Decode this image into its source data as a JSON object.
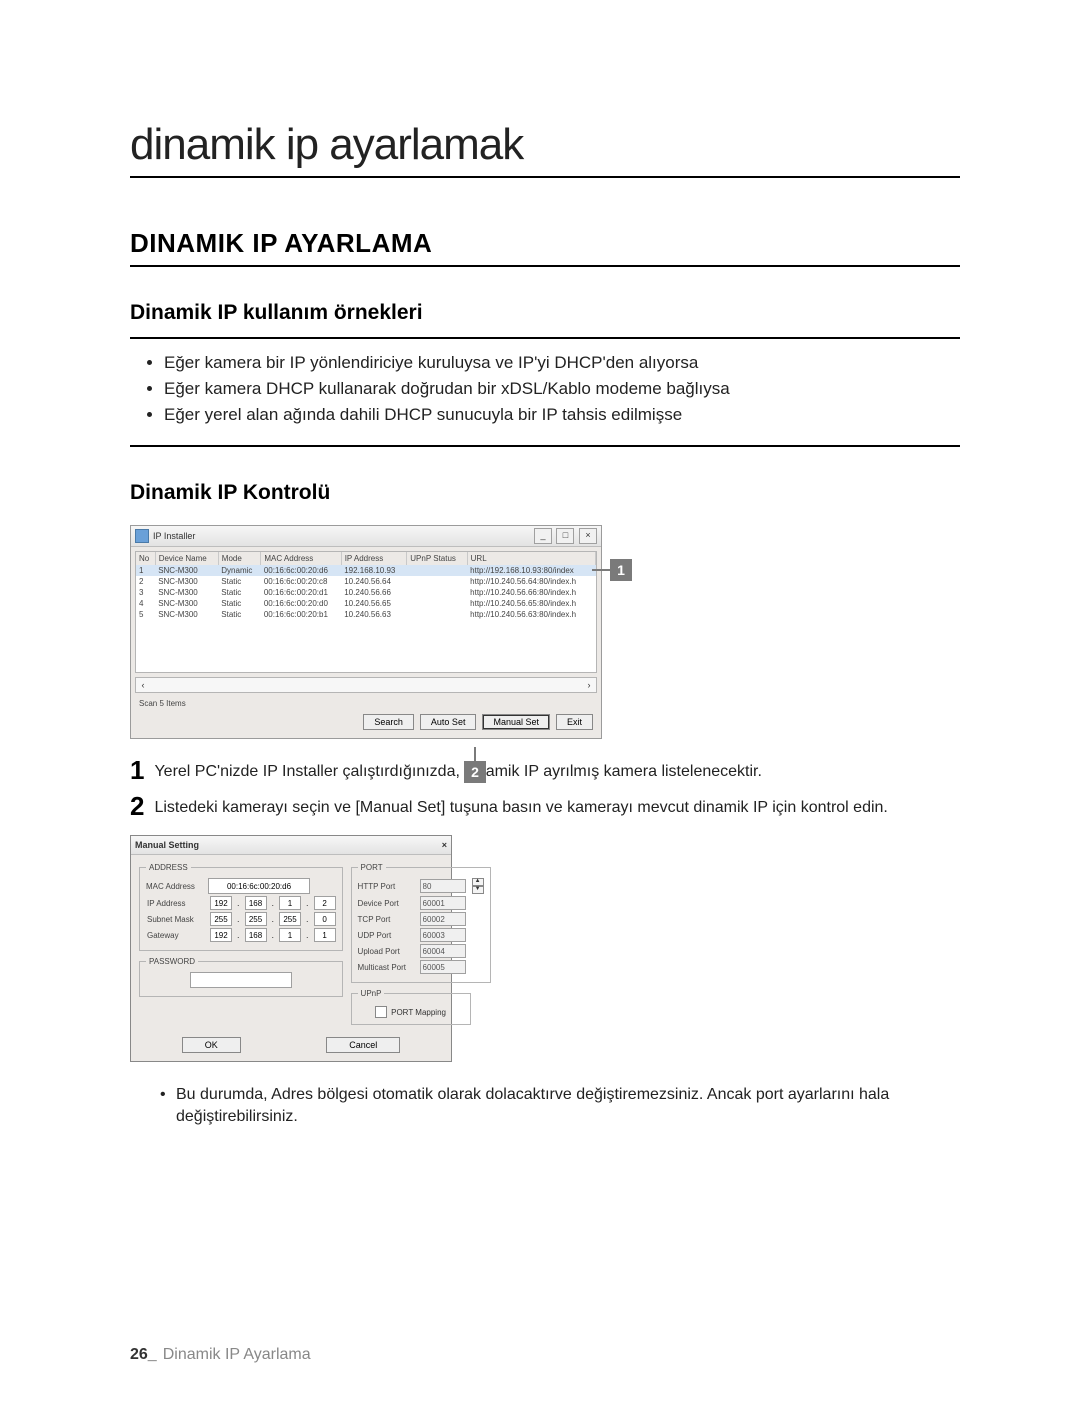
{
  "title": "dinamik ip ayarlamak",
  "h2": "DINAMIK IP AYARLAMA",
  "h3a": "Dinamik IP kullanım örnekleri",
  "bullets": [
    "Eğer kamera bir IP yönlendiriciye kuruluysa ve IP'yi DHCP'den alıyorsa",
    "Eğer kamera DHCP kullanarak doğrudan bir xDSL/Kablo modeme bağlıysa",
    "Eğer yerel alan ağında dahili DHCP sunucuyla bir IP tahsis edilmişse"
  ],
  "h3b": "Dinamik IP Kontrolü",
  "installer": {
    "title": "IP Installer",
    "cols": [
      "No",
      "Device Name",
      "Mode",
      "MAC Address",
      "IP Address",
      "UPnP Status",
      "URL"
    ],
    "rows": [
      {
        "no": "1",
        "name": "SNC-M300",
        "mode": "Dynamic",
        "mac": "00:16:6c:00:20:d6",
        "ip": "192.168.10.93",
        "url": "http://192.168.10.93:80/index"
      },
      {
        "no": "2",
        "name": "SNC-M300",
        "mode": "Static",
        "mac": "00:16:6c:00:20:c8",
        "ip": "10.240.56.64",
        "url": "http://10.240.56.64:80/index.h"
      },
      {
        "no": "3",
        "name": "SNC-M300",
        "mode": "Static",
        "mac": "00:16:6c:00:20:d1",
        "ip": "10.240.56.66",
        "url": "http://10.240.56.66:80/index.h"
      },
      {
        "no": "4",
        "name": "SNC-M300",
        "mode": "Static",
        "mac": "00:16:6c:00:20:d0",
        "ip": "10.240.56.65",
        "url": "http://10.240.56.65:80/index.h"
      },
      {
        "no": "5",
        "name": "SNC-M300",
        "mode": "Static",
        "mac": "00:16:6c:00:20:b1",
        "ip": "10.240.56.63",
        "url": "http://10.240.56.63:80/index.h"
      }
    ],
    "status": "Scan 5 Items",
    "btn_search": "Search",
    "btn_auto": "Auto Set",
    "btn_manual": "Manual Set",
    "btn_exit": "Exit"
  },
  "callout1": "1",
  "callout2": "2",
  "step1": "Yerel PC'nizde IP Installer çalıştırdığınızda, dinamik IP ayrılmış kamera listelenecektir.",
  "step2": "Listedeki kamerayı seçin ve [Manual Set] tuşuna basın ve kamerayı mevcut dinamik IP için kontrol edin.",
  "dlg": {
    "title": "Manual Setting",
    "grp_addr": "ADDRESS",
    "mac_lbl": "MAC Address",
    "mac_val": "00:16:6c:00:20:d6",
    "ip_lbl": "IP Address",
    "ip": [
      "192",
      "168",
      "1",
      "2"
    ],
    "sm_lbl": "Subnet Mask",
    "sm": [
      "255",
      "255",
      "255",
      "0"
    ],
    "gw_lbl": "Gateway",
    "gw": [
      "192",
      "168",
      "1",
      "1"
    ],
    "grp_pwd": "PASSWORD",
    "grp_port": "PORT",
    "ports": [
      {
        "l": "HTTP Port",
        "v": "80"
      },
      {
        "l": "Device Port",
        "v": "60001"
      },
      {
        "l": "TCP Port",
        "v": "60002"
      },
      {
        "l": "UDP Port",
        "v": "60003"
      },
      {
        "l": "Upload Port",
        "v": "60004"
      },
      {
        "l": "Multicast Port",
        "v": "60005"
      }
    ],
    "grp_upnp": "UPnP",
    "upnp_chk": "PORT Mapping",
    "ok": "OK",
    "cancel": "Cancel"
  },
  "note": "Bu durumda, Adres bölgesi otomatik olarak dolacaktırve değiştiremezsiniz. Ancak port ayarlarını hala değiştirebilirsiniz.",
  "footer_num": "26_",
  "footer_txt": "Dinamik IP Ayarlama"
}
